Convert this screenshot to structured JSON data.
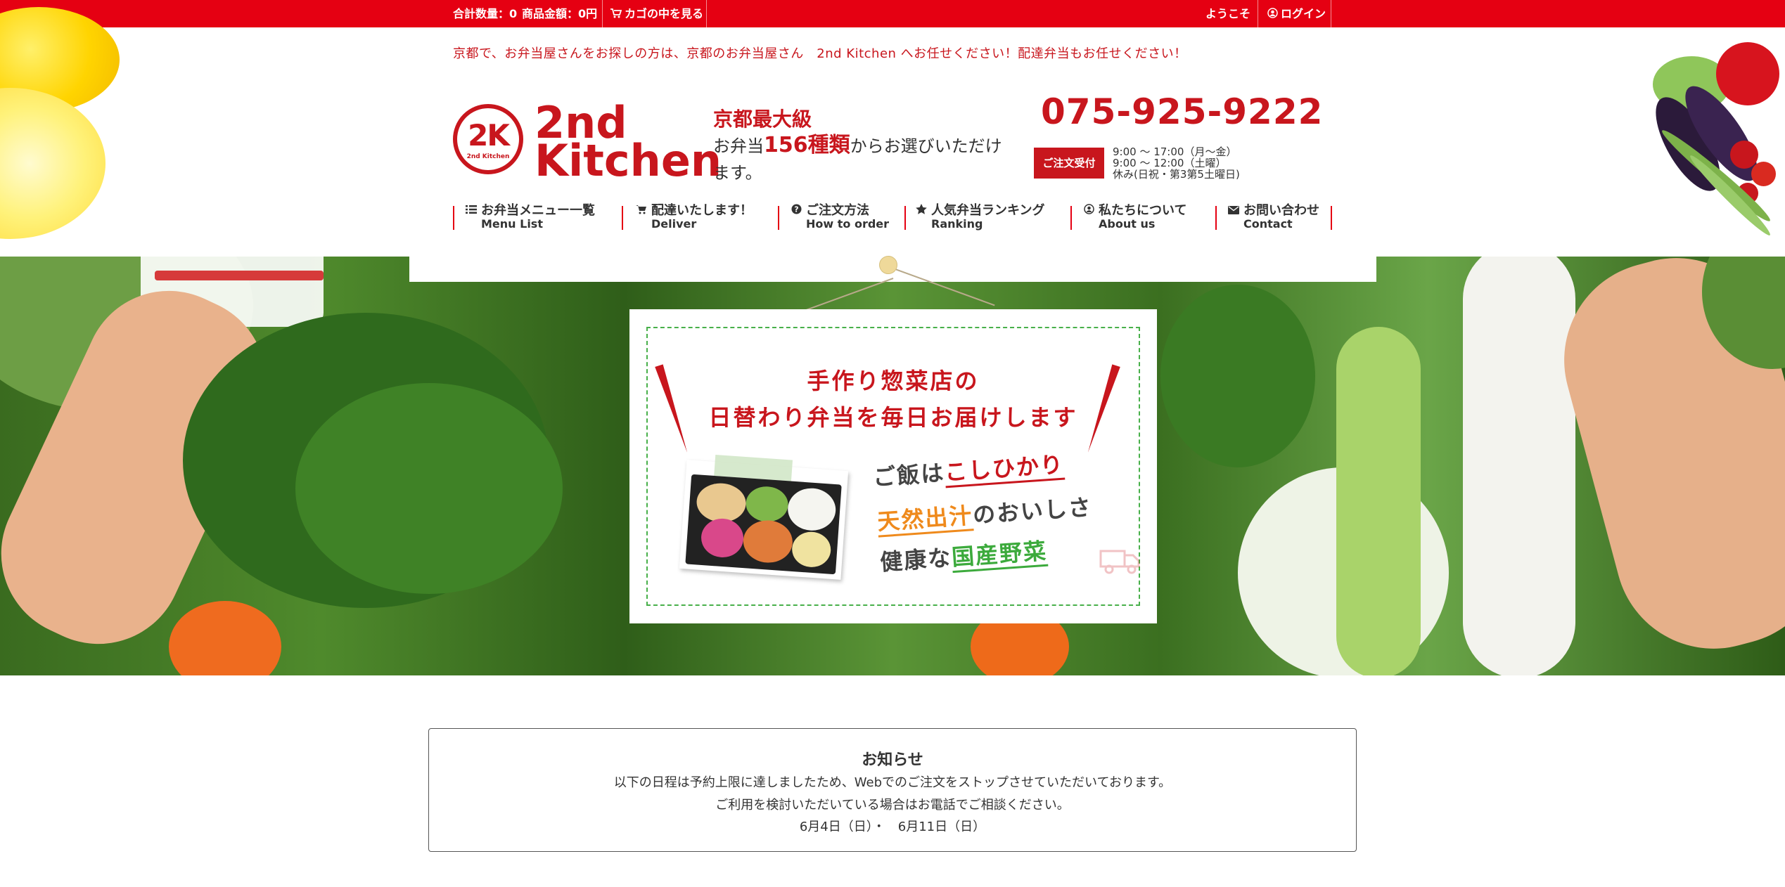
{
  "topbar": {
    "total_count": "合計数量：0",
    "total_price": "商品金額：0円",
    "cart_link": "カゴの中を見る",
    "welcome": "ようこそ",
    "login": "ログイン"
  },
  "header": {
    "tagline": "京都で、お弁当屋さんをお探しの方は、京都のお弁当屋さん　2nd Kitchen へお任せください！配達弁当もお任せください！",
    "logo_mark": "2K",
    "logo_mark_small": "2nd Kitchen",
    "logo_word1": "2nd",
    "logo_word2": "Kitchen",
    "catch_title": "京都最大級",
    "catch_pre": "お弁当",
    "catch_number": "156種類",
    "catch_post": "からお選びいただけます。",
    "phone": "075-925-9222",
    "order_badge": "ご注文受付",
    "hours_1": "9:00 ～ 17:00（月～金）",
    "hours_2": "9:00 ～ 12:00（土曜）",
    "hours_3": "休み(日祝・第3第5土曜日)"
  },
  "nav": [
    {
      "jp": "お弁当メニュー一覧",
      "en": "Menu List",
      "icon": "list-icon"
    },
    {
      "jp": "配達いたします！",
      "en": "Deliver",
      "icon": "cart-icon"
    },
    {
      "jp": "ご注文方法",
      "en": "How to order",
      "icon": "question-icon"
    },
    {
      "jp": "人気弁当ランキング",
      "en": "Ranking",
      "icon": "star-icon"
    },
    {
      "jp": "私たちについて",
      "en": "About us",
      "icon": "user-circle-icon"
    },
    {
      "jp": "お問い合わせ",
      "en": "Contact",
      "icon": "envelope-icon"
    }
  ],
  "hero": {
    "headline1": "手作り惣菜店の",
    "headline2": "日替わり弁当を毎日お届けします",
    "feature1_a": "ご飯は",
    "feature1_b": "こしひかり",
    "feature2_a": "天然出汁",
    "feature2_b": "のおいしさ",
    "feature3_a": "健康な",
    "feature3_b": "国産野菜"
  },
  "notice": {
    "title": "お知らせ",
    "line1": "以下の日程は予約上限に達しましたため、Webでのご注文をストップさせていただいております。",
    "line2": "ご利用を検討いただいている場合はお電話でご相談ください。",
    "line3": "6月4日（日）・　6月11日（日）"
  },
  "colors": {
    "brand_red": "#e50012",
    "logo_red": "#c8161d",
    "accent_orange": "#ef8a1c",
    "accent_green": "#3caa3c"
  }
}
